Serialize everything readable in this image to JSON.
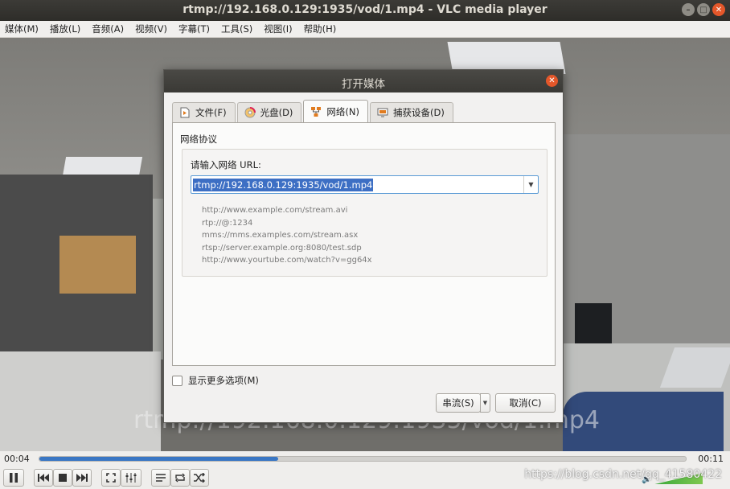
{
  "window": {
    "title": "rtmp://192.168.0.129:1935/vod/1.mp4 - VLC media player"
  },
  "menubar": {
    "items": [
      "媒体(M)",
      "播放(L)",
      "音频(A)",
      "视频(V)",
      "字幕(T)",
      "工具(S)",
      "视图(I)",
      "帮助(H)"
    ]
  },
  "video": {
    "overlay_text": "rtmp://192.168.0.129:1935/vod/1.mp4"
  },
  "dialog": {
    "title": "打开媒体",
    "tabs": [
      {
        "label": "文件(F)",
        "icon": "file-icon"
      },
      {
        "label": "光盘(D)",
        "icon": "disc-icon"
      },
      {
        "label": "网络(N)",
        "icon": "network-icon",
        "active": true
      },
      {
        "label": "捕获设备(D)",
        "icon": "capture-device-icon"
      }
    ],
    "protocol_label": "网络协议",
    "url_label": "请输入网络 URL:",
    "url_value": "rtmp://192.168.0.129:1935/vod/1.mp4",
    "examples": [
      "http://www.example.com/stream.avi",
      "rtp://@:1234",
      "mms://mms.examples.com/stream.asx",
      "rtsp://server.example.org:8080/test.sdp",
      "http://www.yourtube.com/watch?v=gg64x"
    ],
    "more_options_label": "显示更多选项(M)",
    "stream_button": "串流(S)",
    "cancel_button": "取消(C)"
  },
  "playback": {
    "current_time": "00:04",
    "total_time": "00:11",
    "progress": 0.37
  },
  "watermark": "https://blog.csdn.net/qq_41580422",
  "colors": {
    "accent": "#3a77c4",
    "close": "#e4572a",
    "selection": "#3d6fc4"
  }
}
